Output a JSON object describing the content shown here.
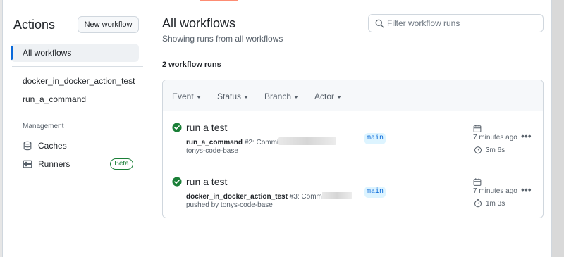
{
  "sidebar": {
    "title": "Actions",
    "new_workflow_label": "New workflow",
    "items": [
      {
        "label": "All workflows",
        "selected": true
      },
      {
        "label": "docker_in_docker_action_test",
        "selected": false
      },
      {
        "label": "run_a_command",
        "selected": false
      }
    ],
    "section_label": "Management",
    "management": [
      {
        "label": "Caches",
        "icon": "database-icon"
      },
      {
        "label": "Runners",
        "icon": "server-icon",
        "badge": "Beta"
      }
    ]
  },
  "main": {
    "title": "All workflows",
    "subtitle": "Showing runs from all workflows",
    "filter_placeholder": "Filter workflow runs",
    "run_count": "2 workflow runs",
    "filters": [
      "Event",
      "Status",
      "Branch",
      "Actor"
    ],
    "runs": [
      {
        "title": "run a test",
        "workflow": "run_a_command",
        "run_number": "#2: Commi",
        "actor_line": "tonys-code-base",
        "branch": "main",
        "time_ago": "7 minutes ago",
        "duration": "3m 6s",
        "status": "success"
      },
      {
        "title": "run a test",
        "workflow": "docker_in_docker_action_test",
        "run_number": "#3: Comm",
        "actor_line": "pushed by tonys-code-base",
        "branch": "main",
        "time_ago": "7 minutes ago",
        "duration": "1m 3s",
        "status": "success"
      }
    ]
  },
  "colors": {
    "accent": "#0969da",
    "success": "#1a7f37",
    "tab_underline": "#fd8c73"
  }
}
